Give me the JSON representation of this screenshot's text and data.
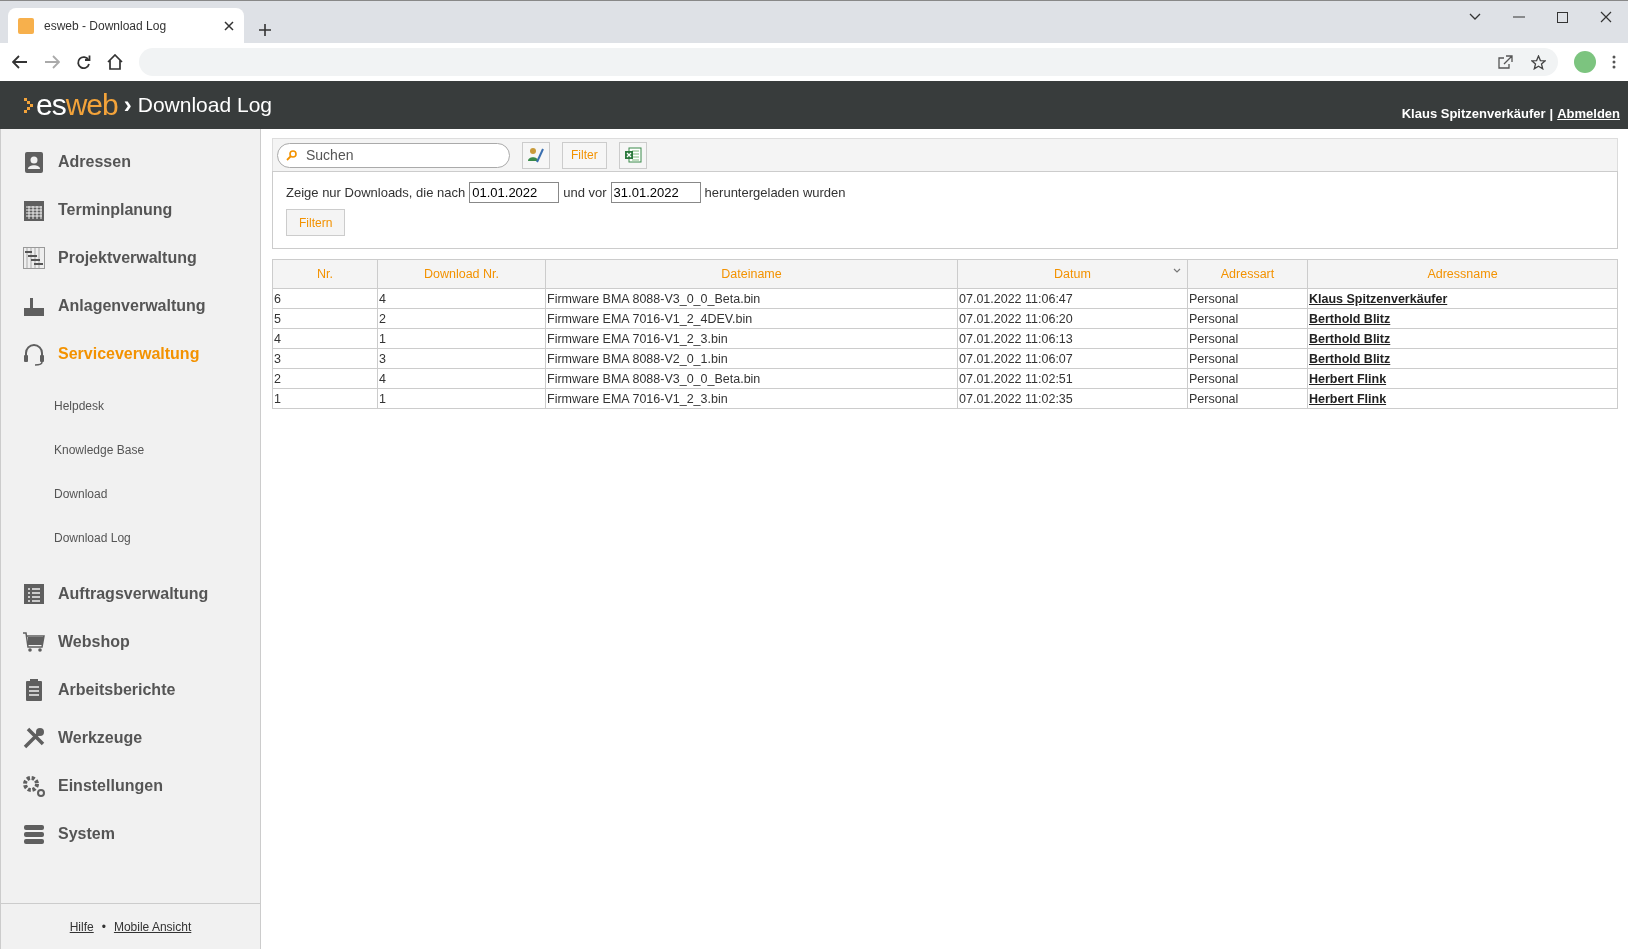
{
  "browser": {
    "tab_title": "esweb - Download Log"
  },
  "header": {
    "logo_es": "es",
    "logo_web": "web",
    "separator": "›",
    "title": "Download Log",
    "user": "Klaus Spitzenverkäufer",
    "divider": "|",
    "logout": "Abmelden"
  },
  "sidebar": {
    "items": [
      {
        "label": "Adressen",
        "selected": false
      },
      {
        "label": "Terminplanung",
        "selected": false
      },
      {
        "label": "Projektverwaltung",
        "selected": false
      },
      {
        "label": "Anlagenverwaltung",
        "selected": false
      },
      {
        "label": "Serviceverwaltung",
        "selected": true,
        "children": [
          {
            "label": "Helpdesk"
          },
          {
            "label": "Knowledge Base"
          },
          {
            "label": "Download"
          },
          {
            "label": "Download Log"
          }
        ]
      },
      {
        "label": "Auftragsverwaltung",
        "selected": false
      },
      {
        "label": "Webshop",
        "selected": false
      },
      {
        "label": "Arbeitsberichte",
        "selected": false
      },
      {
        "label": "Werkzeuge",
        "selected": false
      },
      {
        "label": "Einstellungen",
        "selected": false
      },
      {
        "label": "System",
        "selected": false
      }
    ],
    "footer": {
      "help": "Hilfe",
      "dot": "•",
      "mobile": "Mobile Ansicht"
    }
  },
  "toolbar": {
    "search": {
      "placeholder": "Suchen"
    },
    "filter_button": "Filter"
  },
  "filter": {
    "text_before": "Zeige nur Downloads, die nach",
    "from": "01.01.2022",
    "text_middle": "und vor",
    "to": "31.01.2022",
    "text_after": "heruntergeladen wurden",
    "button": "Filtern"
  },
  "table": {
    "columns": [
      {
        "label": "Nr.",
        "sorted": false
      },
      {
        "label": "Download Nr.",
        "sorted": false
      },
      {
        "label": "Dateiname",
        "sorted": false
      },
      {
        "label": "Datum",
        "sorted": true
      },
      {
        "label": "Adressart",
        "sorted": false
      },
      {
        "label": "Adressname",
        "sorted": false
      }
    ],
    "rows": [
      [
        "6",
        "4",
        "Firmware BMA 8088-V3_0_0_Beta.bin",
        "07.01.2022 11:06:47",
        "Personal",
        "Klaus Spitzenverkäufer"
      ],
      [
        "5",
        "2",
        "Firmware EMA 7016-V1_2_4DEV.bin",
        "07.01.2022 11:06:20",
        "Personal",
        "Berthold Blitz"
      ],
      [
        "4",
        "1",
        "Firmware EMA 7016-V1_2_3.bin",
        "07.01.2022 11:06:13",
        "Personal",
        "Berthold Blitz"
      ],
      [
        "3",
        "3",
        "Firmware BMA 8088-V2_0_1.bin",
        "07.01.2022 11:06:07",
        "Personal",
        "Berthold Blitz"
      ],
      [
        "2",
        "4",
        "Firmware BMA 8088-V3_0_0_Beta.bin",
        "07.01.2022 11:02:51",
        "Personal",
        "Herbert Flink"
      ],
      [
        "1",
        "1",
        "Firmware EMA 7016-V1_2_3.bin",
        "07.01.2022 11:02:35",
        "Personal",
        "Herbert Flink"
      ]
    ]
  }
}
